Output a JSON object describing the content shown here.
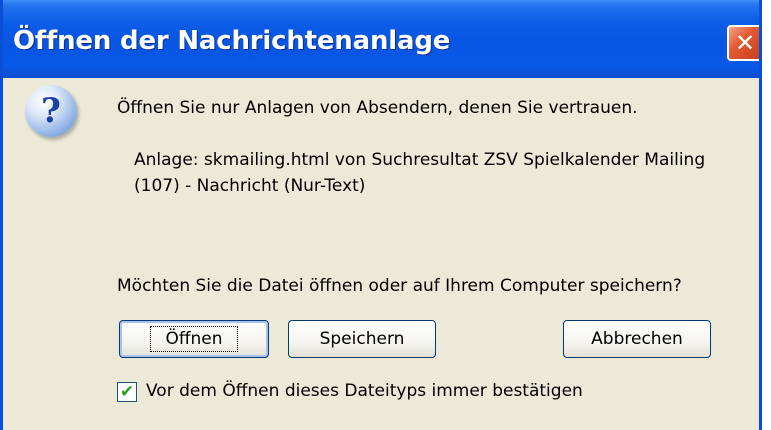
{
  "window": {
    "title": "Öffnen der Nachrichtenanlage",
    "close_icon": "close-icon"
  },
  "message": {
    "icon": "question-mark-icon",
    "icon_glyph": "?",
    "warning": "Öffnen Sie nur Anlagen von Absendern, denen Sie vertrauen.",
    "attachment_line1": "Anlage: skmailing.html von Suchresultat ZSV Spielkalender Mailing",
    "attachment_line2": "(107) - Nachricht (Nur-Text)",
    "question": "Möchten Sie die Datei öffnen oder auf Ihrem Computer speichern?"
  },
  "buttons": {
    "open": "Öffnen",
    "save": "Speichern",
    "cancel": "Abbrechen"
  },
  "checkbox": {
    "label": "Vor dem Öffnen dieses Dateityps immer bestätigen",
    "checked": true
  },
  "colors": {
    "titlebar": "#0755e2",
    "dialog_bg": "#ece9d8",
    "close_button": "#e35a34"
  }
}
